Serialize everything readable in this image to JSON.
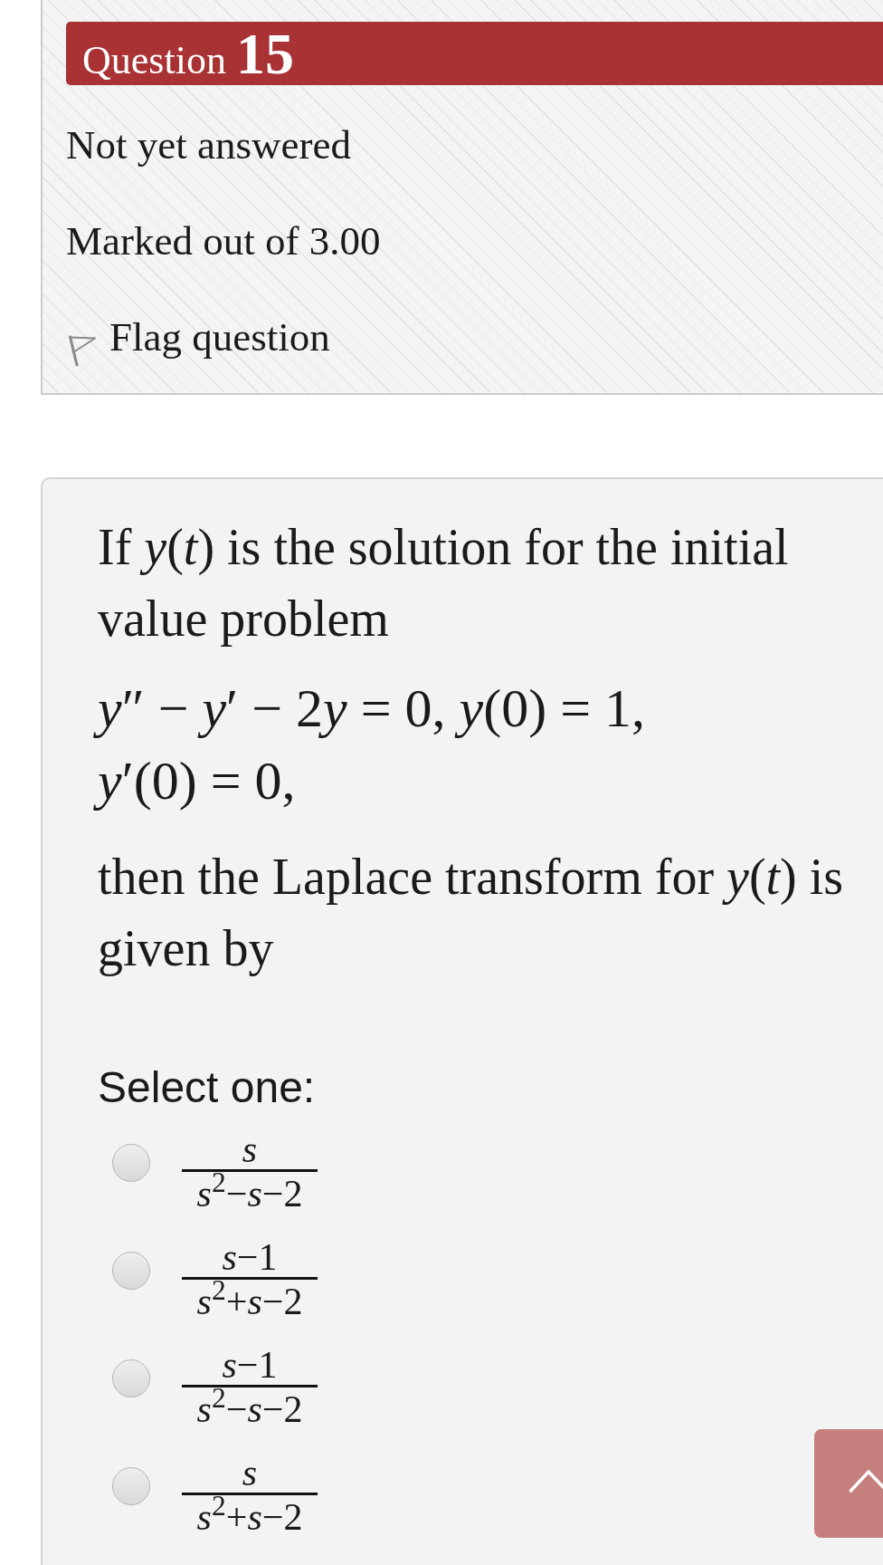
{
  "question_info": {
    "label": "Question",
    "number": "15",
    "status": "Not yet answered",
    "grade": "Marked out of 3.00",
    "flag": {
      "label": "Flag question",
      "flagged": false
    }
  },
  "question": {
    "intro": "If *y*(*t*) is the solution for the initial value problem",
    "equation_lines": [
      "y″ − y′ − 2y = 0, y(0) = 1,",
      "y′(0) = 0,"
    ],
    "conclusion": "then the Laplace transform for *y*(*t*) is given by",
    "prompt": "Select one:",
    "options": [
      {
        "numerator": "s",
        "denominator": "s$^{2}$−s−2",
        "selected": false
      },
      {
        "numerator": "s−1",
        "denominator": "s$^{2}$+s−2",
        "selected": false
      },
      {
        "numerator": "s−1",
        "denominator": "s$^{2}$−s−2",
        "selected": false
      },
      {
        "numerator": "s",
        "denominator": "s$^{2}$+s−2",
        "selected": false
      }
    ]
  }
}
